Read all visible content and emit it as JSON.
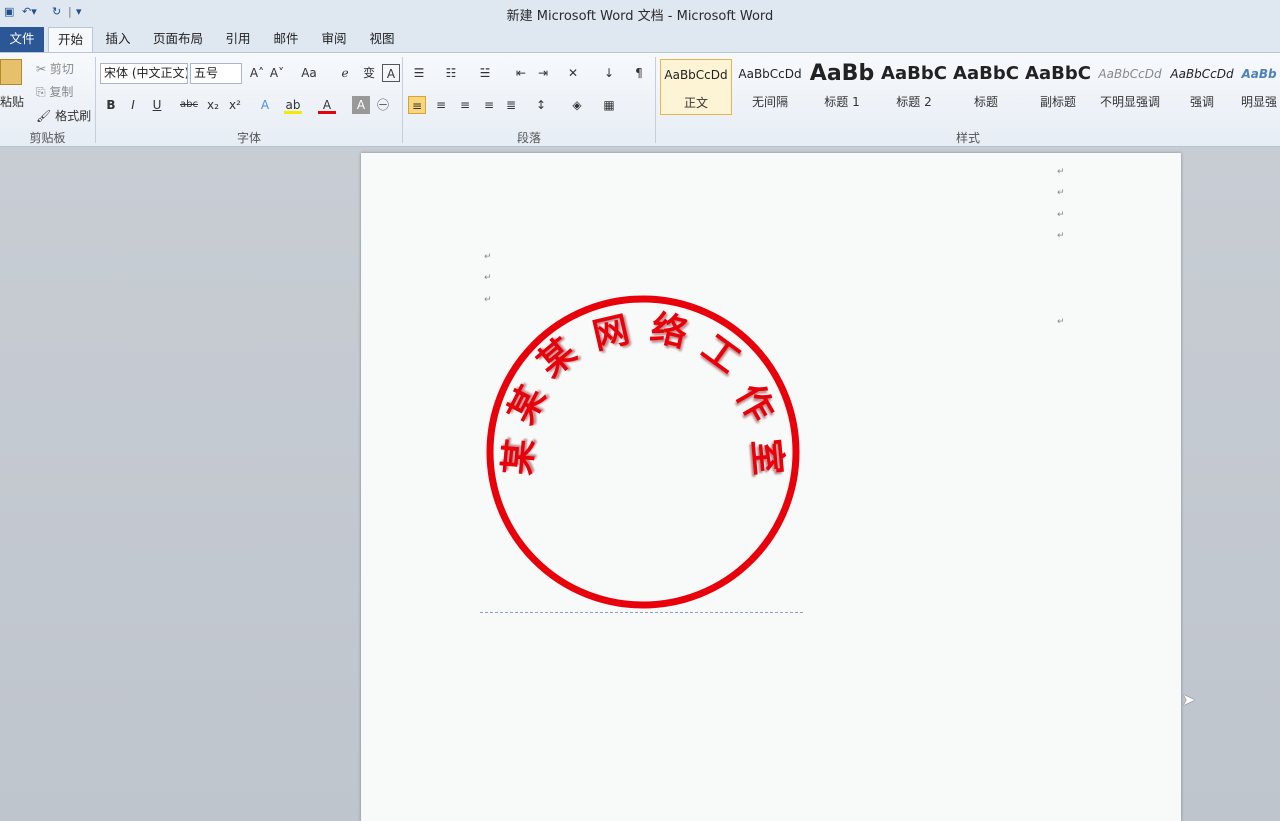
{
  "window": {
    "title": "新建 Microsoft Word 文档 - Microsoft Word"
  },
  "tabs": [
    {
      "label": "文件"
    },
    {
      "label": "开始"
    },
    {
      "label": "插入"
    },
    {
      "label": "页面布局"
    },
    {
      "label": "引用"
    },
    {
      "label": "邮件"
    },
    {
      "label": "审阅"
    },
    {
      "label": "视图"
    }
  ],
  "clipboard": {
    "paste": "粘贴",
    "cut": "剪切",
    "copy": "复制",
    "format_painter": "格式刷",
    "group_label": "剪贴板"
  },
  "font": {
    "family": "宋体 (中文正文)",
    "size": "五号",
    "group_label": "字体"
  },
  "paragraph": {
    "group_label": "段落"
  },
  "styles": {
    "group_label": "样式",
    "items": [
      {
        "preview": "AaBbCcDd",
        "name": "正文"
      },
      {
        "preview": "AaBbCcDd",
        "name": "无间隔"
      },
      {
        "preview": "AaBb",
        "name": "标题 1"
      },
      {
        "preview": "AaBbC",
        "name": "标题 2"
      },
      {
        "preview": "AaBbC",
        "name": "标题"
      },
      {
        "preview": "AaBbC",
        "name": "副标题"
      },
      {
        "preview": "AaBbCcDd",
        "name": "不明显强调"
      },
      {
        "preview": "AaBbCcDd",
        "name": "强调"
      },
      {
        "preview": "AaBb",
        "name": "明显强"
      }
    ]
  },
  "document": {
    "seal_text": [
      "某",
      "某",
      "某",
      "网",
      "络",
      "工",
      "作",
      "室"
    ],
    "paragraph_mark": "↵",
    "seal_color": "#e8000b"
  }
}
